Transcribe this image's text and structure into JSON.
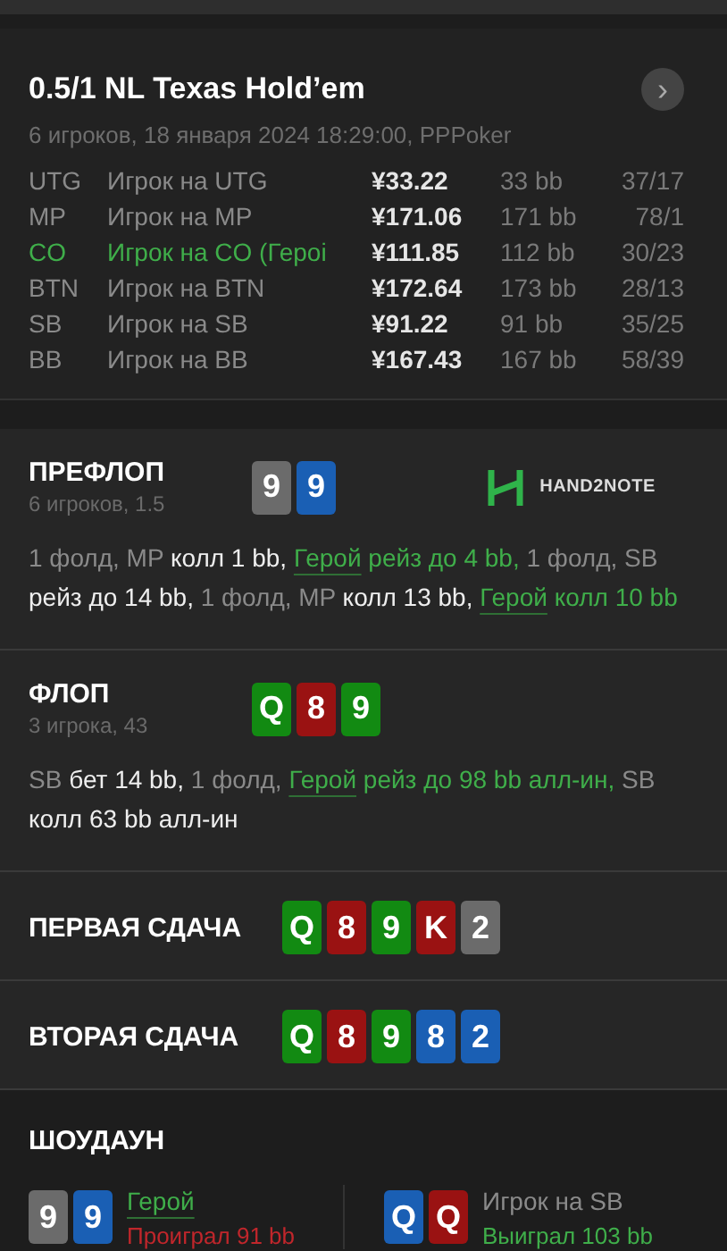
{
  "header": {
    "title": "0.5/1 NL Texas Hold’em",
    "subtitle": "6 игроков, 18 января 2024 18:29:00, PPPoker",
    "next_button": "›"
  },
  "players": [
    {
      "position": "UTG",
      "name": "Игрок на UTG",
      "stack": "¥33.22",
      "bb": "33 bb",
      "stats": "37/17",
      "hero": false
    },
    {
      "position": "MP",
      "name": "Игрок на MP",
      "stack": "¥171.06",
      "bb": "171 bb",
      "stats": "78/1",
      "hero": false
    },
    {
      "position": "CO",
      "name": "Игрок на CO (Герoi",
      "stack": "¥111.85",
      "bb": "112 bb",
      "stats": "30/23",
      "hero": true
    },
    {
      "position": "BTN",
      "name": "Игрок на BTN",
      "stack": "¥172.64",
      "bb": "173 bb",
      "stats": "28/13",
      "hero": false
    },
    {
      "position": "SB",
      "name": "Игрок на SB",
      "stack": "¥91.22",
      "bb": "91 bb",
      "stats": "35/25",
      "hero": false
    },
    {
      "position": "BB",
      "name": "Игрок на BB",
      "stack": "¥167.43",
      "bb": "167 bb",
      "stats": "58/39",
      "hero": false
    }
  ],
  "streets": [
    {
      "title": "ПРЕФЛОП",
      "info": "6 игроков, 1.5",
      "logo": "HAND2NOTE",
      "cards": [
        {
          "rank": "9",
          "color": "#6b6b6b"
        },
        {
          "rank": "9",
          "color": "#1a5fb4"
        }
      ],
      "actions": [
        {
          "kind": "muted",
          "text": "1 фолд, MP "
        },
        {
          "kind": "action",
          "text": "колл 1 bb, "
        },
        {
          "kind": "hero",
          "text": "Герой"
        },
        {
          "kind": "hero_action",
          "text": " рейз до 4 bb, "
        },
        {
          "kind": "muted",
          "text": "1 фолд, SB "
        },
        {
          "kind": "action",
          "text": "рейз до 14 bb, "
        },
        {
          "kind": "muted",
          "text": "1 фолд, MP "
        },
        {
          "kind": "action",
          "text": "колл 13 bb, "
        },
        {
          "kind": "hero",
          "text": "Герой"
        },
        {
          "kind": "hero_action",
          "text": " колл 10 bb"
        }
      ]
    },
    {
      "title": "ФЛОП",
      "info": "3 игрока, 43",
      "cards": [
        {
          "rank": "Q",
          "color": "#128a12"
        },
        {
          "rank": "8",
          "color": "#9a1212"
        },
        {
          "rank": "9",
          "color": "#128a12"
        }
      ],
      "actions": [
        {
          "kind": "muted",
          "text": "SB "
        },
        {
          "kind": "action",
          "text": "бет 14 bb, "
        },
        {
          "kind": "muted",
          "text": "1 фолд, "
        },
        {
          "kind": "hero",
          "text": "Герой"
        },
        {
          "kind": "hero_action",
          "text": " рейз до 98 bb алл-ин, "
        },
        {
          "kind": "muted",
          "text": "SB "
        },
        {
          "kind": "action",
          "text": "колл 63 bb алл-ин"
        }
      ]
    },
    {
      "title": "ПЕРВАЯ СДАЧА",
      "cards": [
        {
          "rank": "Q",
          "color": "#128a12"
        },
        {
          "rank": "8",
          "color": "#9a1212"
        },
        {
          "rank": "9",
          "color": "#128a12"
        },
        {
          "rank": "K",
          "color": "#9a1212"
        },
        {
          "rank": "2",
          "color": "#6b6b6b"
        }
      ]
    },
    {
      "title": "ВТОРАЯ СДАЧА",
      "cards": [
        {
          "rank": "Q",
          "color": "#128a12"
        },
        {
          "rank": "8",
          "color": "#9a1212"
        },
        {
          "rank": "9",
          "color": "#128a12"
        },
        {
          "rank": "8",
          "color": "#1a5fb4"
        },
        {
          "rank": "2",
          "color": "#1a5fb4"
        }
      ]
    }
  ],
  "showdown": {
    "title": "ШОУДАУН",
    "hands": [
      {
        "name": "Герой",
        "hero": true,
        "result": "Проиграл 91 bb",
        "won": false,
        "cards": [
          {
            "rank": "9",
            "color": "#6b6b6b"
          },
          {
            "rank": "9",
            "color": "#1a5fb4"
          }
        ]
      },
      {
        "name": "Игрок на SB",
        "hero": false,
        "result": "Выиграл 103 bb",
        "won": true,
        "cards": [
          {
            "rank": "Q",
            "color": "#1a5fb4"
          },
          {
            "rank": "Q",
            "color": "#9a1212"
          }
        ]
      }
    ]
  }
}
